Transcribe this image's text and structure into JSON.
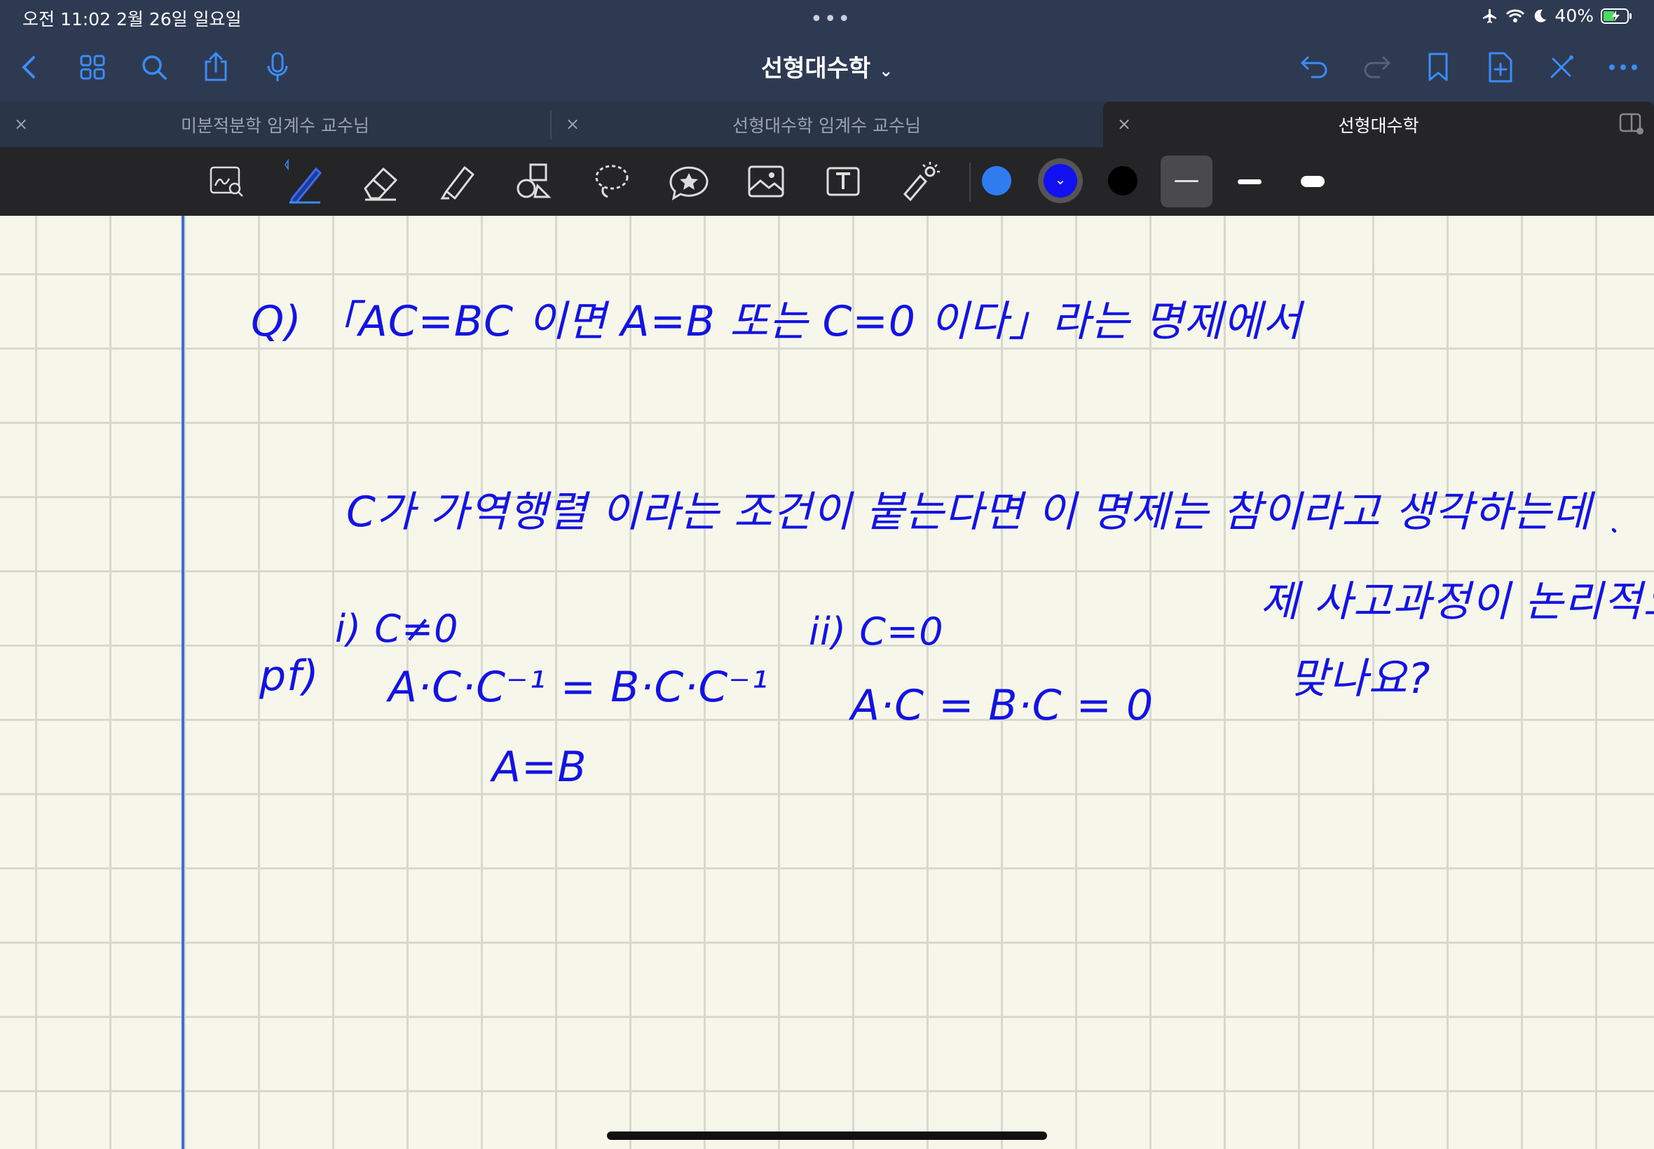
{
  "status_bar": {
    "time_date": "오전 11:02   2월 26일 일요일",
    "battery": "40%",
    "icons": [
      "airplane-icon",
      "wifi-icon",
      "moon-icon",
      "battery-icon"
    ]
  },
  "nav": {
    "title": "선형대수학",
    "title_chevron": "⌄",
    "left_icons": [
      "back-icon",
      "grid-icon",
      "search-icon",
      "share-icon",
      "microphone-icon"
    ],
    "right_icons": [
      "undo-icon",
      "redo-icon",
      "bookmark-icon",
      "add-page-icon",
      "close-tools-icon",
      "more-icon"
    ]
  },
  "tabs": [
    {
      "label": "미분적분학 임계수 교수님",
      "close": "×"
    },
    {
      "label": "선형대수학 임계수 교수님",
      "close": "×"
    },
    {
      "label": "선형대수학",
      "close": "×",
      "active": true
    }
  ],
  "toolbar": {
    "tools": [
      "zoom-pen-icon",
      "pen-icon",
      "eraser-icon",
      "highlighter-icon",
      "shapes-icon",
      "lasso-icon",
      "sticker-icon",
      "image-icon",
      "text-icon",
      "laser-pointer-icon"
    ],
    "colors": [
      "#2f7bf0",
      "#1010f0",
      "#000000"
    ],
    "selected_color": "#1010f0",
    "thicknesses": [
      "thin",
      "medium",
      "thick"
    ],
    "selected_thickness": "thin"
  },
  "note": {
    "ink_color": "#1414e0",
    "line1": "Q)  「AC=BC 이면   A=B  또는  C=0  이다」라는 명제에서",
    "line2": "C가  가역행렬 이라는 조건이  붙는다면  이 명제는 참이라고 생각하는데",
    "line3a": "제 사고과정이 논리적으로",
    "line3b": "맞나요?",
    "proof_label": "pf)",
    "case1_head": "i) C≠0",
    "case1_eq1": "A·C·C⁻¹ = B·C·C⁻¹",
    "case1_eq2": "A=B",
    "case2_head": "ii)  C=0",
    "case2_eq1": "A·C = B·C = 0"
  }
}
